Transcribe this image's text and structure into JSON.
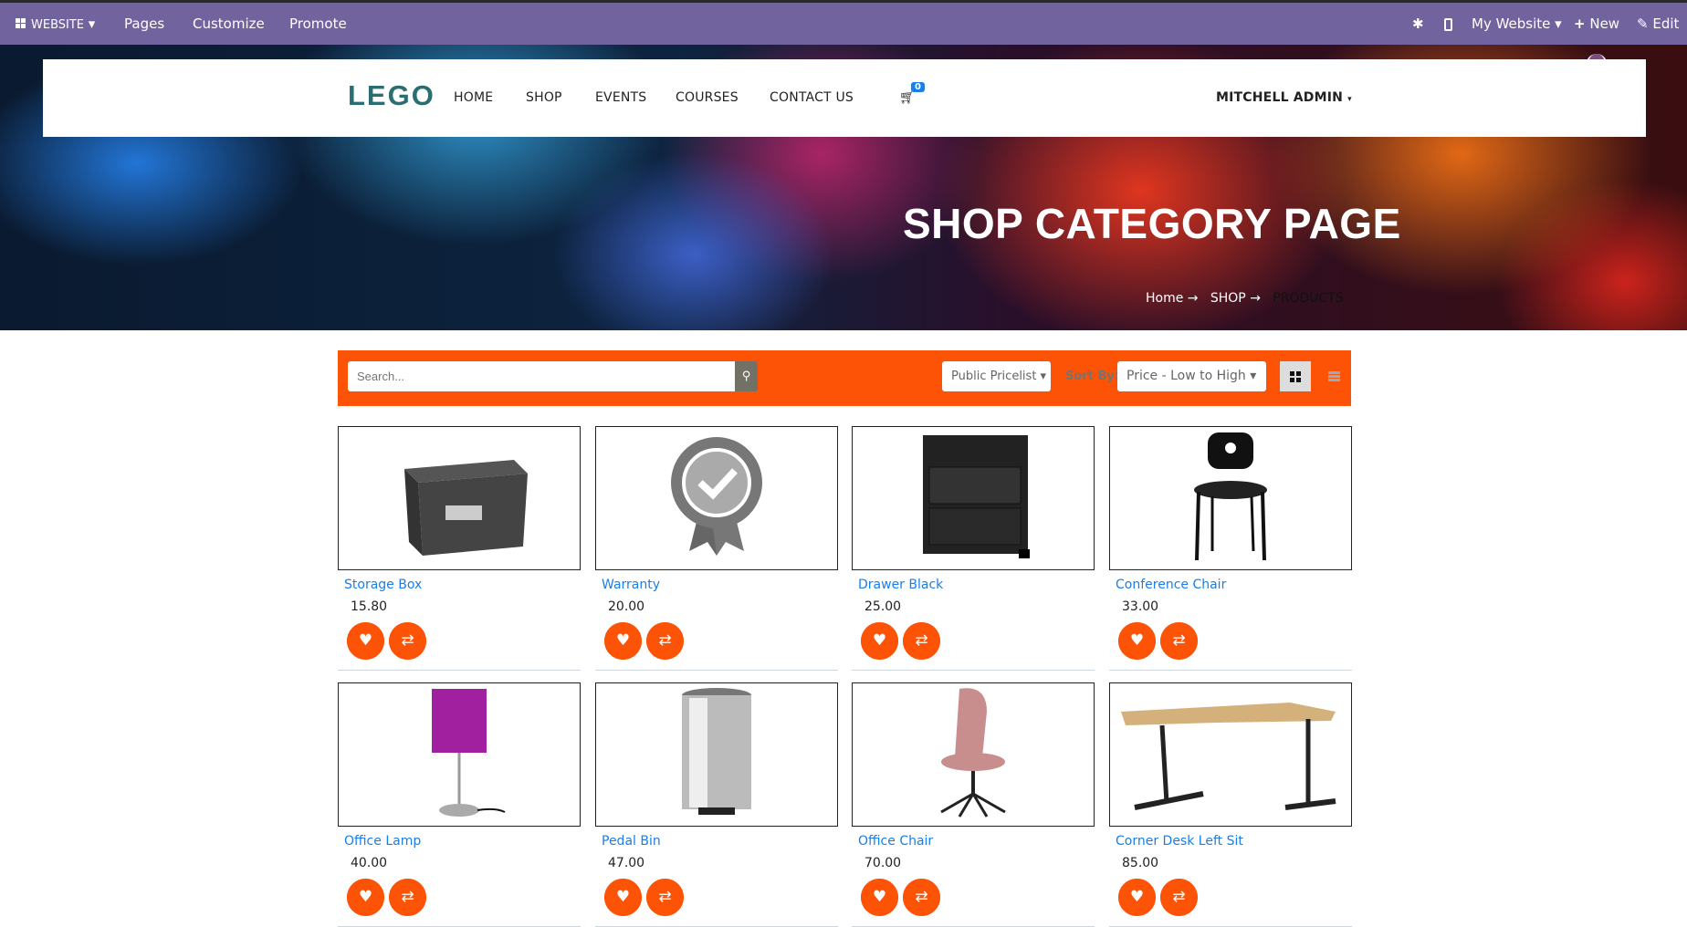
{
  "topbar": {
    "website": "WEBSITE",
    "pages": "Pages",
    "customize": "Customize",
    "promote": "Promote",
    "my_website": "My Website",
    "new": "New",
    "edit": "Edit"
  },
  "header": {
    "logo": "LEGO",
    "nav": [
      "HOME",
      "SHOP",
      "EVENTS",
      "COURSES",
      "CONTACT US"
    ],
    "cart_count": "0",
    "user": "MITCHELL ADMIN"
  },
  "hero": {
    "title": "SHOP CATEGORY PAGE",
    "breadcrumb": [
      "Home",
      "SHOP",
      "PRODUCTS"
    ]
  },
  "toolbar": {
    "search_placeholder": "Search...",
    "pricelist": "Public Pricelist",
    "sort_label": "Sort By:",
    "sort_value": "Price - Low to High",
    "accent": "#fc5306"
  },
  "products": [
    {
      "name": "Storage Box",
      "price": "15.80",
      "icon": "storage-box"
    },
    {
      "name": "Warranty",
      "price": "20.00",
      "icon": "warranty-badge"
    },
    {
      "name": "Drawer Black",
      "price": "25.00",
      "icon": "drawer"
    },
    {
      "name": "Conference Chair",
      "price": "33.00",
      "icon": "chair"
    },
    {
      "name": "Office Lamp",
      "price": "40.00",
      "icon": "lamp"
    },
    {
      "name": "Pedal Bin",
      "price": "47.00",
      "icon": "bin"
    },
    {
      "name": "Office Chair",
      "price": "70.00",
      "icon": "office-chair"
    },
    {
      "name": "Corner Desk Left Sit",
      "price": "85.00",
      "icon": "desk"
    }
  ]
}
